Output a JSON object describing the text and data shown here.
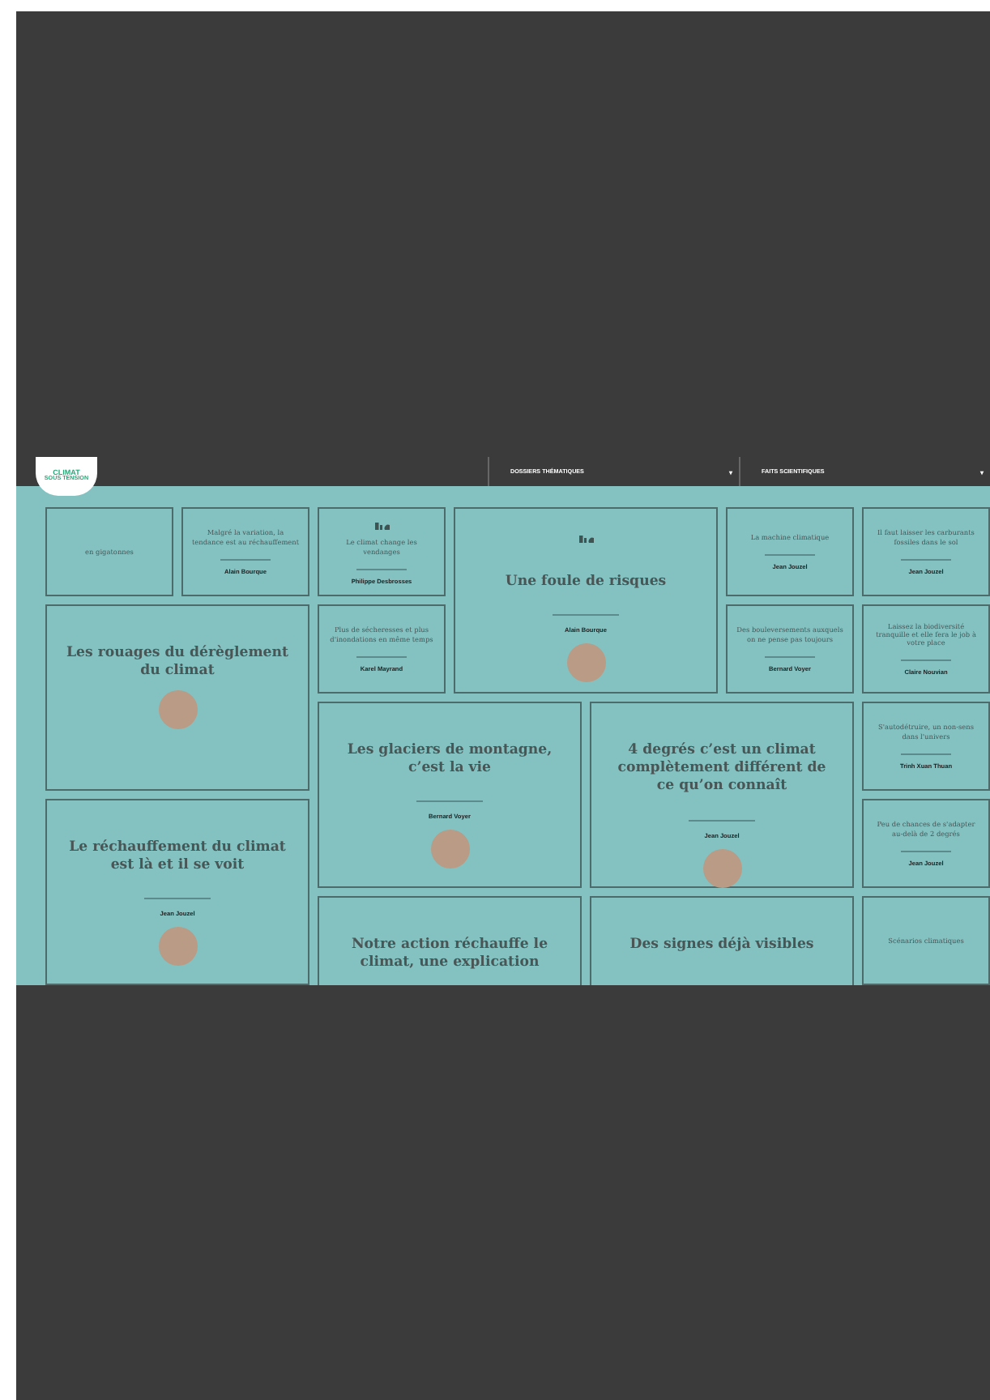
{
  "header": {
    "logo": {
      "line_1": "CLIMAT",
      "line_2": "SOUS TENSION"
    },
    "nav": [
      {
        "label": "DOSSIERS THÉMATIQUES",
        "caret": "▾"
      },
      {
        "label": "FAITS SCIENTIFIQUES",
        "caret": "▾"
      }
    ]
  },
  "cards": [
    {
      "kind": "small",
      "text": "en gigatonnes"
    },
    {
      "kind": "small",
      "text": "Malgré la variation, la tendance est au réchauffement",
      "author": "Alain Bourque"
    },
    {
      "kind": "small",
      "text": "Le climat change les vendanges",
      "author": "Philippe Desbrosses",
      "icon": true
    },
    {
      "kind": "big",
      "text": "Une foule de risques",
      "author": "Alain Bourque",
      "icon": true,
      "photo": true
    },
    {
      "kind": "small",
      "text": "La machine climatique",
      "author": "Jean Jouzel"
    },
    {
      "kind": "small",
      "text": "Il faut laisser les carburants fossiles dans le sol",
      "author": "Jean Jouzel"
    },
    {
      "kind": "big",
      "text": "Les rouages du dérèglement du climat",
      "photo": true
    },
    {
      "kind": "small",
      "text": "Plus de sécheresses et plus d'inondations en même temps",
      "author": "Karel Mayrand"
    },
    {
      "kind": "small",
      "text": "Des bouleversements auxquels on ne pense pas toujours",
      "author": "Bernard Voyer"
    },
    {
      "kind": "small",
      "text": "Laissez la biodiversité tranquille et elle fera le job à votre place",
      "author": "Claire Nouvian"
    },
    {
      "kind": "big",
      "text": "Les glaciers de montagne, c’est la vie",
      "author": "Bernard Voyer",
      "photo": true
    },
    {
      "kind": "big",
      "text": "4 degrés c’est un climat complètement différent de ce qu’on connaît",
      "author": "Jean Jouzel",
      "photo": true
    },
    {
      "kind": "small",
      "text": "S'autodétruire, un non-sens dans l'univers",
      "author": "Trinh Xuan Thuan"
    },
    {
      "kind": "big",
      "text": "Le réchauffement du climat est là et il se voit",
      "author": "Jean Jouzel",
      "photo": true
    },
    {
      "kind": "small",
      "text": "Peu de chances de s'adapter au-delà de 2 degrés",
      "author": "Jean Jouzel"
    },
    {
      "kind": "big",
      "text": "Notre action réchauffe le climat, une explication"
    },
    {
      "kind": "big",
      "text": "Des signes déjà visibles"
    },
    {
      "kind": "small",
      "text": "Scénarios climatiques"
    }
  ]
}
